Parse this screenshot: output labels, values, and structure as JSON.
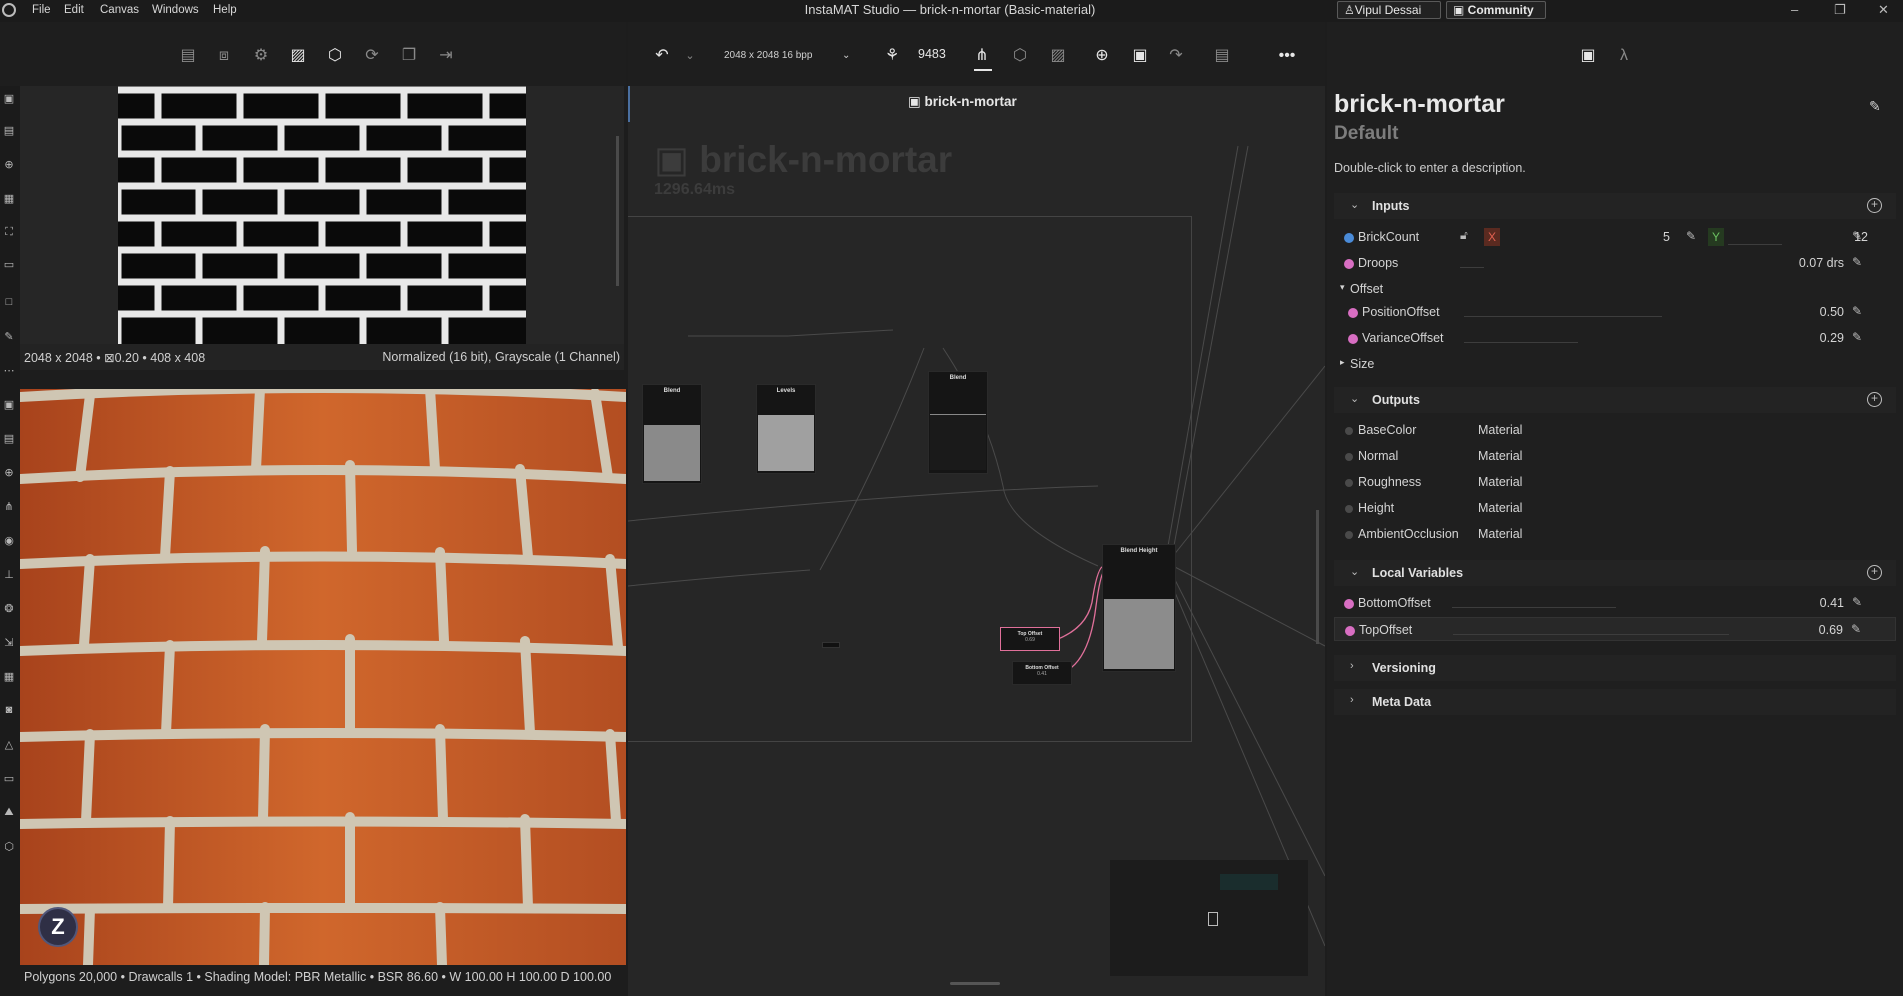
{
  "window": {
    "title": "InstaMAT Studio — brick-n-mortar (Basic-material)",
    "menu": [
      "File",
      "Edit",
      "Canvas",
      "Windows",
      "Help"
    ],
    "user": "Vipul Dessai",
    "community": "Community",
    "controls": [
      "–",
      "❐",
      "✕"
    ]
  },
  "toolbar": {
    "resolution": "2048 x 2048 16 bpp",
    "seed": "9483"
  },
  "texture_preview": {
    "info_left": "2048 x 2048 • ⊠0.20 • 408 x 408",
    "info_right": "Normalized (16 bit), Grayscale (1 Channel)"
  },
  "viewport3d": {
    "status": "Polygons 20,000 • Drawcalls 1 • Shading Model: PBR Metallic • BSR 86.60 • W 100.00 H 100.00 D 100.00",
    "avatar_letter": "Z"
  },
  "graph": {
    "tab_title": "brick-n-mortar",
    "watermark_title": "brick-n-mortar",
    "timing": "1296.64ms",
    "nodes": {
      "blend1": "Blend",
      "levels": "Levels",
      "blend2": "Blend",
      "blend_height": "Blend Height",
      "top_offset": "Top Offset",
      "top_offset_val": "0.69",
      "bottom_offset": "Bottom Offset",
      "bottom_offset_val": "0.41"
    }
  },
  "properties": {
    "title": "brick-n-mortar",
    "subtitle": "Default",
    "description": "Double-click to enter a description.",
    "sections": {
      "inputs": "Inputs",
      "outputs": "Outputs",
      "local_vars": "Local Variables",
      "versioning": "Versioning",
      "meta": "Meta Data"
    },
    "inputs": {
      "brickcount_label": "BrickCount",
      "x_label": "X",
      "x_value": "5",
      "y_label": "Y",
      "y_value": "12",
      "droops_label": "Droops",
      "droops_value": "0.07 drs",
      "offset_group": "Offset",
      "position_offset_label": "PositionOffset",
      "position_offset_value": "0.50",
      "variance_offset_label": "VarianceOffset",
      "variance_offset_value": "0.29",
      "size_group": "Size"
    },
    "outputs": [
      {
        "name": "BaseColor",
        "type": "Material"
      },
      {
        "name": "Normal",
        "type": "Material"
      },
      {
        "name": "Roughness",
        "type": "Material"
      },
      {
        "name": "Height",
        "type": "Material"
      },
      {
        "name": "AmbientOcclusion",
        "type": "Material"
      }
    ],
    "local_vars": {
      "bottom_label": "BottomOffset",
      "bottom_value": "0.41",
      "top_label": "TopOffset",
      "top_value": "0.69"
    }
  }
}
